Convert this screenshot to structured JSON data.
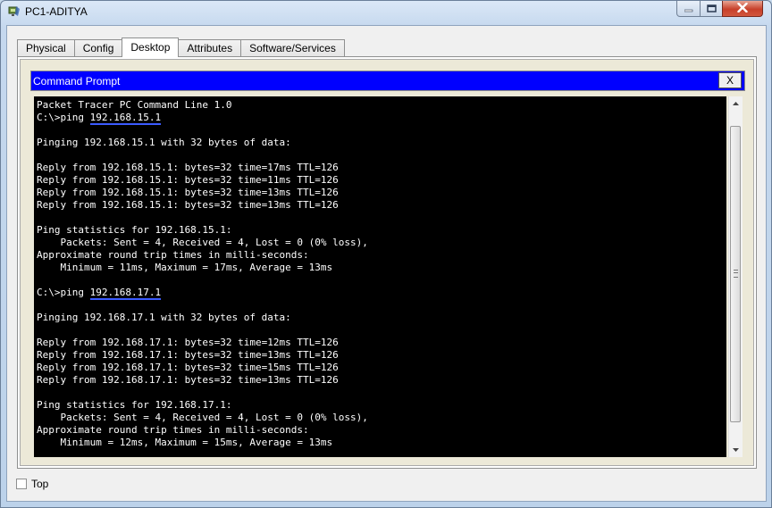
{
  "window": {
    "title": "PC1-ADITYA",
    "icon": "packet-tracer-pc-icon",
    "minimize_glyph": "–",
    "maximize_glyph": "□",
    "close_glyph": "✕"
  },
  "tabs": [
    {
      "label": "Physical"
    },
    {
      "label": "Config"
    },
    {
      "label": "Desktop",
      "active": true
    },
    {
      "label": "Attributes"
    },
    {
      "label": "Software/Services"
    }
  ],
  "command_prompt": {
    "title": "Command Prompt",
    "close_label": "X",
    "lines": [
      "Packet Tracer PC Command Line 1.0",
      "C:\\>ping 192.168.15.1",
      "",
      "Pinging 192.168.15.1 with 32 bytes of data:",
      "",
      "Reply from 192.168.15.1: bytes=32 time=17ms TTL=126",
      "Reply from 192.168.15.1: bytes=32 time=11ms TTL=126",
      "Reply from 192.168.15.1: bytes=32 time=13ms TTL=126",
      "Reply from 192.168.15.1: bytes=32 time=13ms TTL=126",
      "",
      "Ping statistics for 192.168.15.1:",
      "    Packets: Sent = 4, Received = 4, Lost = 0 (0% loss),",
      "Approximate round trip times in milli-seconds:",
      "    Minimum = 11ms, Maximum = 17ms, Average = 13ms",
      "",
      "C:\\>ping 192.168.17.1",
      "",
      "Pinging 192.168.17.1 with 32 bytes of data:",
      "",
      "Reply from 192.168.17.1: bytes=32 time=12ms TTL=126",
      "Reply from 192.168.17.1: bytes=32 time=13ms TTL=126",
      "Reply from 192.168.17.1: bytes=32 time=15ms TTL=126",
      "Reply from 192.168.17.1: bytes=32 time=13ms TTL=126",
      "",
      "Ping statistics for 192.168.17.1:",
      "    Packets: Sent = 4, Received = 4, Lost = 0 (0% loss),",
      "Approximate round trip times in milli-seconds:",
      "    Minimum = 12ms, Maximum = 15ms, Average = 13ms"
    ],
    "highlighted_lines": [
      1,
      15
    ],
    "highlight_color": "#3b5bff",
    "scrollbar": {
      "up_icon": "scroll-up-icon",
      "down_icon": "scroll-down-icon"
    }
  },
  "footer": {
    "top_checkbox_label": "Top",
    "top_checked": false
  },
  "colors": {
    "titlebar_blue": "#0000ff",
    "console_bg": "#000000",
    "console_fg": "#ffffff"
  }
}
